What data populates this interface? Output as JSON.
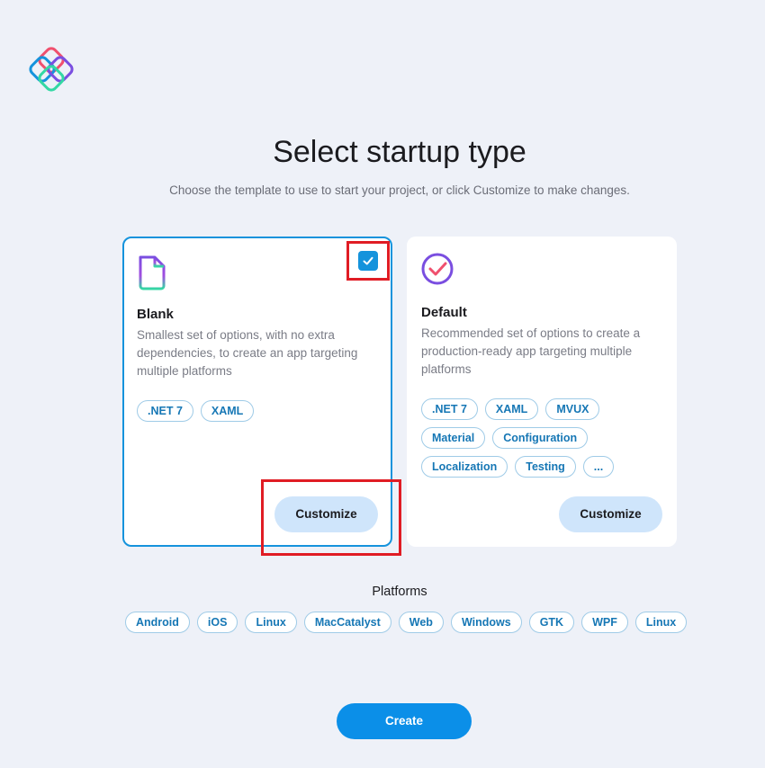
{
  "header": {
    "title": "Select startup type",
    "subtitle": "Choose the template to use to start your project, or click Customize to make changes."
  },
  "cards": [
    {
      "title": "Blank",
      "description": "Smallest set of options, with no extra dependencies, to create an app targeting multiple platforms",
      "tags": [
        ".NET 7",
        "XAML"
      ],
      "customize_label": "Customize",
      "selected": true
    },
    {
      "title": "Default",
      "description": "Recommended set of options to create a production-ready app targeting multiple platforms",
      "tags": [
        ".NET 7",
        "XAML",
        "MVUX",
        "Material",
        "Configuration",
        "Localization",
        "Testing",
        "..."
      ],
      "customize_label": "Customize",
      "selected": false
    }
  ],
  "platforms": {
    "title": "Platforms",
    "items": [
      "Android",
      "iOS",
      "Linux",
      "MacCatalyst",
      "Web",
      "Windows",
      "GTK",
      "WPF",
      "Linux"
    ]
  },
  "footer": {
    "create_label": "Create"
  },
  "colors": {
    "accent": "#1593dc",
    "highlight": "#e01c24",
    "button_light": "#cfe5fb",
    "create": "#0b8fe8"
  }
}
